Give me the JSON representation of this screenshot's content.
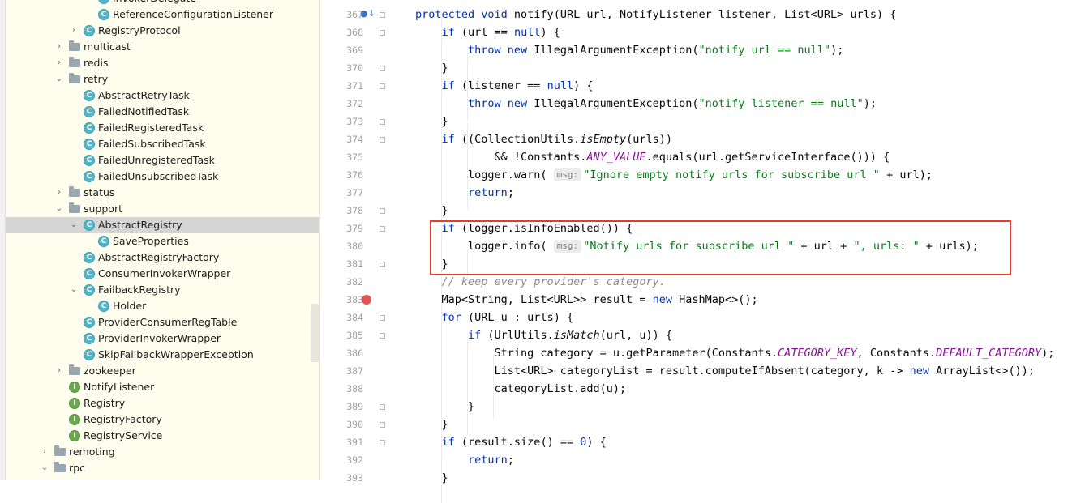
{
  "project_tree": {
    "items": [
      {
        "label": "InvokerDelegate",
        "kind": "class",
        "depth": 3,
        "arrow": ""
      },
      {
        "label": "ReferenceConfigurationListener",
        "kind": "class",
        "depth": 3,
        "arrow": ""
      },
      {
        "label": "RegistryProtocol",
        "kind": "class",
        "depth": 2,
        "arrow": "collapsed"
      },
      {
        "label": "multicast",
        "kind": "folder",
        "depth": 1,
        "arrow": "collapsed"
      },
      {
        "label": "redis",
        "kind": "folder",
        "depth": 1,
        "arrow": "collapsed"
      },
      {
        "label": "retry",
        "kind": "folder",
        "depth": 1,
        "arrow": "expanded"
      },
      {
        "label": "AbstractRetryTask",
        "kind": "class",
        "depth": 2,
        "arrow": ""
      },
      {
        "label": "FailedNotifiedTask",
        "kind": "class",
        "depth": 2,
        "arrow": ""
      },
      {
        "label": "FailedRegisteredTask",
        "kind": "class",
        "depth": 2,
        "arrow": ""
      },
      {
        "label": "FailedSubscribedTask",
        "kind": "class",
        "depth": 2,
        "arrow": ""
      },
      {
        "label": "FailedUnregisteredTask",
        "kind": "class",
        "depth": 2,
        "arrow": ""
      },
      {
        "label": "FailedUnsubscribedTask",
        "kind": "class",
        "depth": 2,
        "arrow": ""
      },
      {
        "label": "status",
        "kind": "folder",
        "depth": 1,
        "arrow": "collapsed"
      },
      {
        "label": "support",
        "kind": "folder",
        "depth": 1,
        "arrow": "expanded"
      },
      {
        "label": "AbstractRegistry",
        "kind": "class",
        "depth": 2,
        "arrow": "expanded",
        "selected": true
      },
      {
        "label": "SaveProperties",
        "kind": "class",
        "depth": 3,
        "arrow": ""
      },
      {
        "label": "AbstractRegistryFactory",
        "kind": "class",
        "depth": 2,
        "arrow": ""
      },
      {
        "label": "ConsumerInvokerWrapper",
        "kind": "class",
        "depth": 2,
        "arrow": ""
      },
      {
        "label": "FailbackRegistry",
        "kind": "class",
        "depth": 2,
        "arrow": "expanded"
      },
      {
        "label": "Holder",
        "kind": "class",
        "depth": 3,
        "arrow": ""
      },
      {
        "label": "ProviderConsumerRegTable",
        "kind": "class",
        "depth": 2,
        "arrow": ""
      },
      {
        "label": "ProviderInvokerWrapper",
        "kind": "class",
        "depth": 2,
        "arrow": ""
      },
      {
        "label": "SkipFailbackWrapperException",
        "kind": "class",
        "depth": 2,
        "arrow": ""
      },
      {
        "label": "zookeeper",
        "kind": "folder",
        "depth": 1,
        "arrow": "collapsed"
      },
      {
        "label": "NotifyListener",
        "kind": "interface",
        "depth": 1,
        "arrow": ""
      },
      {
        "label": "Registry",
        "kind": "interface",
        "depth": 1,
        "arrow": ""
      },
      {
        "label": "RegistryFactory",
        "kind": "interface",
        "depth": 1,
        "arrow": ""
      },
      {
        "label": "RegistryService",
        "kind": "interface",
        "depth": 1,
        "arrow": ""
      },
      {
        "label": "remoting",
        "kind": "folder",
        "depth": 0,
        "arrow": "collapsed"
      },
      {
        "label": "rpc",
        "kind": "folder",
        "depth": 0,
        "arrow": "expanded"
      }
    ]
  },
  "editor": {
    "line_numbers": [
      "367",
      "368",
      "369",
      "370",
      "371",
      "372",
      "373",
      "374",
      "375",
      "376",
      "377",
      "378",
      "379",
      "380",
      "381",
      "382",
      "383",
      "384",
      "385",
      "386",
      "387",
      "388",
      "389",
      "390",
      "391",
      "392",
      "393"
    ],
    "lines": [
      [
        {
          "t": "protected void ",
          "c": "kw"
        },
        {
          "t": "notify(URL url, NotifyListener listener, List<URL> urls) {"
        }
      ],
      [
        {
          "t": "    "
        },
        {
          "t": "if ",
          "c": "kw"
        },
        {
          "t": "(url == "
        },
        {
          "t": "null",
          "c": "kw"
        },
        {
          "t": ") {"
        }
      ],
      [
        {
          "t": "        "
        },
        {
          "t": "throw new ",
          "c": "kw"
        },
        {
          "t": "IllegalArgumentException("
        },
        {
          "t": "\"notify url == null\"",
          "c": "str"
        },
        {
          "t": ");"
        }
      ],
      [
        {
          "t": "    }"
        }
      ],
      [
        {
          "t": "    "
        },
        {
          "t": "if ",
          "c": "kw"
        },
        {
          "t": "(listener == "
        },
        {
          "t": "null",
          "c": "kw"
        },
        {
          "t": ") {"
        }
      ],
      [
        {
          "t": "        "
        },
        {
          "t": "throw new ",
          "c": "kw"
        },
        {
          "t": "IllegalArgumentException("
        },
        {
          "t": "\"notify listener == null\"",
          "c": "str"
        },
        {
          "t": ");"
        }
      ],
      [
        {
          "t": "    }"
        }
      ],
      [
        {
          "t": "    "
        },
        {
          "t": "if ",
          "c": "kw"
        },
        {
          "t": "((CollectionUtils."
        },
        {
          "t": "isEmpty",
          "c": "it"
        },
        {
          "t": "(urls))"
        }
      ],
      [
        {
          "t": "            && !Constants."
        },
        {
          "t": "ANY_VALUE",
          "c": "cst"
        },
        {
          "t": ".equals(url.getServiceInterface())) {"
        }
      ],
      [
        {
          "t": "        logger.warn( "
        },
        {
          "t": "msg:",
          "c": "hint"
        },
        {
          "t": "\"Ignore empty notify urls for subscribe url \"",
          "c": "str"
        },
        {
          "t": " + url);"
        }
      ],
      [
        {
          "t": "        "
        },
        {
          "t": "return",
          "c": "kw"
        },
        {
          "t": ";"
        }
      ],
      [
        {
          "t": "    }"
        }
      ],
      [
        {
          "t": "    "
        },
        {
          "t": "if ",
          "c": "kw"
        },
        {
          "t": "(logger.isInfoEnabled()) {"
        }
      ],
      [
        {
          "t": "        logger.info( "
        },
        {
          "t": "msg:",
          "c": "hint"
        },
        {
          "t": "\"Notify urls for subscribe url \"",
          "c": "str"
        },
        {
          "t": " + url + "
        },
        {
          "t": "\", urls: \"",
          "c": "str"
        },
        {
          "t": " + urls);"
        }
      ],
      [
        {
          "t": "    }"
        }
      ],
      [
        {
          "t": "    "
        },
        {
          "t": "// keep every provider's category.",
          "c": "cm"
        }
      ],
      [
        {
          "t": "    Map<String, List<URL>> result = "
        },
        {
          "t": "new ",
          "c": "kw"
        },
        {
          "t": "HashMap<>();"
        }
      ],
      [
        {
          "t": "    "
        },
        {
          "t": "for ",
          "c": "kw"
        },
        {
          "t": "(URL u : urls) {"
        }
      ],
      [
        {
          "t": "        "
        },
        {
          "t": "if ",
          "c": "kw"
        },
        {
          "t": "(UrlUtils."
        },
        {
          "t": "isMatch",
          "c": "it"
        },
        {
          "t": "(url, u)) {"
        }
      ],
      [
        {
          "t": "            String category = u.getParameter(Constants."
        },
        {
          "t": "CATEGORY_KEY",
          "c": "cst"
        },
        {
          "t": ", Constants."
        },
        {
          "t": "DEFAULT_CATEGORY",
          "c": "cst"
        },
        {
          "t": ");"
        }
      ],
      [
        {
          "t": "            List<URL> categoryList = result.computeIfAbsent(category, k -> "
        },
        {
          "t": "new ",
          "c": "kw"
        },
        {
          "t": "ArrayList<>());"
        }
      ],
      [
        {
          "t": "            categoryList.add(u);"
        }
      ],
      [
        {
          "t": "        }"
        }
      ],
      [
        {
          "t": "    }"
        }
      ],
      [
        {
          "t": "    "
        },
        {
          "t": "if ",
          "c": "kw"
        },
        {
          "t": "(result.size() == "
        },
        {
          "t": "0",
          "c": "kw"
        },
        {
          "t": ") {"
        }
      ],
      [
        {
          "t": "        "
        },
        {
          "t": "return",
          "c": "kw"
        },
        {
          "t": ";"
        }
      ],
      [
        {
          "t": "    }"
        }
      ]
    ]
  },
  "gutter_icons": {
    "override_icon": "override-method-icon",
    "breakpoint_icon": "breakpoint-icon",
    "breakpoint_line": "383"
  },
  "colors": {
    "keyword": "#0033b3",
    "string": "#067d17",
    "comment": "#8c8c8c",
    "constant": "#871094",
    "highlight_box": "#e63c2e",
    "breakpoint": "#e55353",
    "tree_bg": "#fffded"
  }
}
